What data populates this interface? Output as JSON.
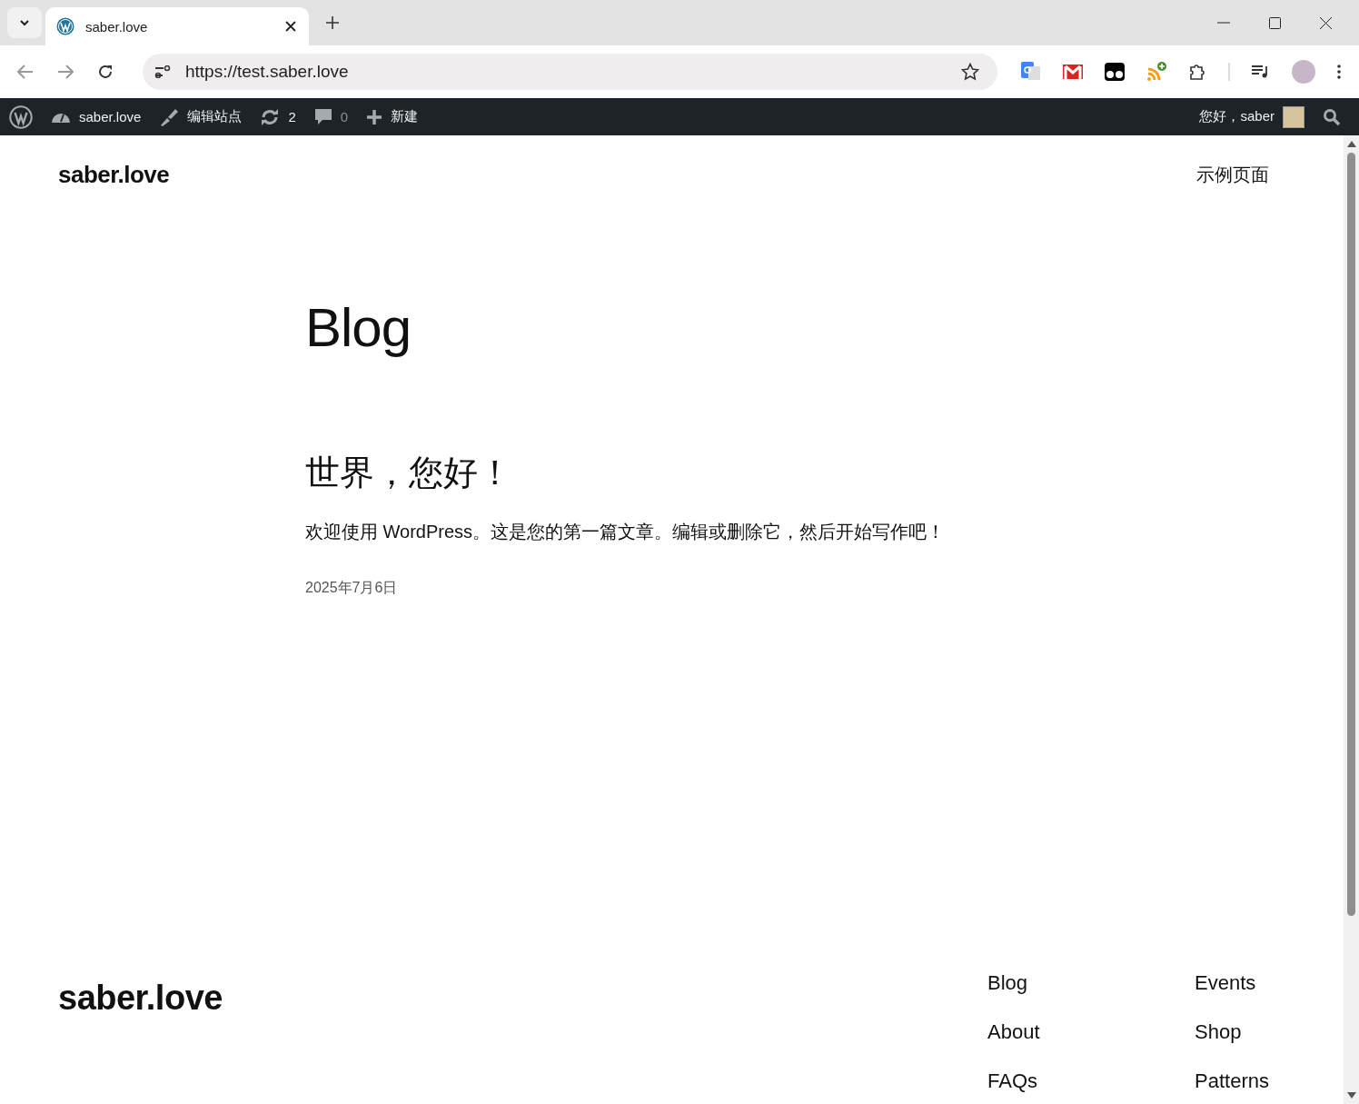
{
  "browser": {
    "tab": {
      "title": "saber.love",
      "selected": true
    },
    "url": "https://test.saber.love"
  },
  "admin_bar": {
    "site": "saber.love",
    "edit_site": "编辑站点",
    "updates": "2",
    "comments": "0",
    "new": "新建",
    "greeting": "您好，saber"
  },
  "header": {
    "site_title": "saber.love",
    "nav": [
      "示例页面"
    ]
  },
  "page_title": "Blog",
  "posts": [
    {
      "title": "世界，您好！",
      "excerpt": "欢迎使用 WordPress。这是您的第一篇文章。编辑或删除它，然后开始写作吧！",
      "date": "2025年7月6日"
    }
  ],
  "footer": {
    "site_title": "saber.love",
    "links": [
      [
        "Blog",
        "About",
        "FAQs"
      ],
      [
        "Events",
        "Shop",
        "Patterns"
      ]
    ]
  }
}
